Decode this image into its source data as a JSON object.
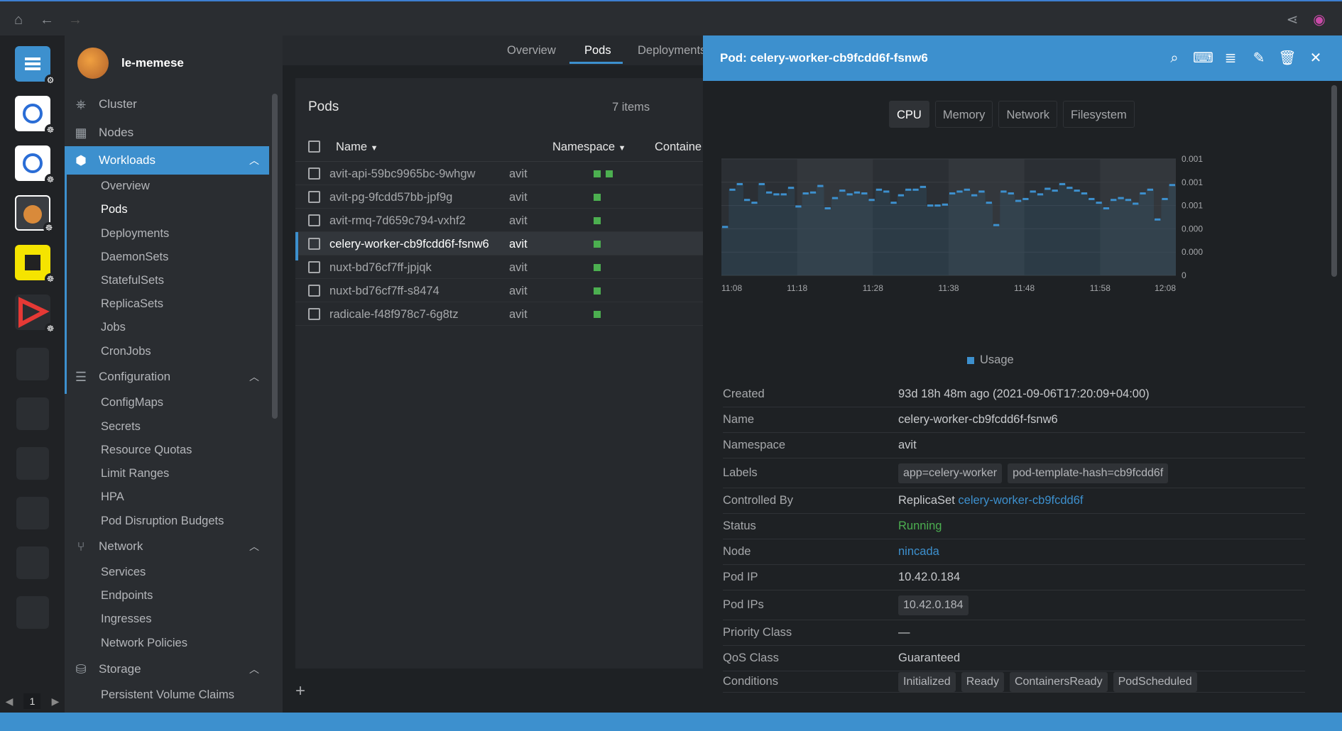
{
  "window": {
    "home_icon": "home-icon",
    "back_icon": "arrow-left-icon",
    "forward_icon": "arrow-right-icon",
    "share_icon": "share-icon",
    "user_icon": "user-circle-icon"
  },
  "hotbar": {
    "page": "1"
  },
  "sidebar": {
    "cluster_name": "le-memese",
    "items": [
      {
        "label": "Cluster"
      },
      {
        "label": "Nodes"
      },
      {
        "label": "Workloads"
      },
      {
        "label": "Configuration"
      },
      {
        "label": "Network"
      },
      {
        "label": "Storage"
      }
    ],
    "workloads": [
      "Overview",
      "Pods",
      "Deployments",
      "DaemonSets",
      "StatefulSets",
      "ReplicaSets",
      "Jobs",
      "CronJobs"
    ],
    "configuration": [
      "ConfigMaps",
      "Secrets",
      "Resource Quotas",
      "Limit Ranges",
      "HPA",
      "Pod Disruption Budgets"
    ],
    "network": [
      "Services",
      "Endpoints",
      "Ingresses",
      "Network Policies"
    ],
    "storage": [
      "Persistent Volume Claims"
    ]
  },
  "tabs": [
    "Overview",
    "Pods",
    "Deployments"
  ],
  "pods": {
    "title": "Pods",
    "count": "7 items",
    "columns": [
      "Name",
      "Namespace",
      "Containe"
    ],
    "rows": [
      {
        "name": "avit-api-59bc9965bc-9whgw",
        "namespace": "avit",
        "containers": 2
      },
      {
        "name": "avit-pg-9fcdd57bb-jpf9g",
        "namespace": "avit",
        "containers": 1
      },
      {
        "name": "avit-rmq-7d659c794-vxhf2",
        "namespace": "avit",
        "containers": 1
      },
      {
        "name": "celery-worker-cb9fcdd6f-fsnw6",
        "namespace": "avit",
        "containers": 1
      },
      {
        "name": "nuxt-bd76cf7ff-jpjqk",
        "namespace": "avit",
        "containers": 1
      },
      {
        "name": "nuxt-bd76cf7ff-s8474",
        "namespace": "avit",
        "containers": 1
      },
      {
        "name": "radicale-f48f978c7-6g8tz",
        "namespace": "avit",
        "containers": 1
      }
    ]
  },
  "drawer": {
    "title": "Pod: celery-worker-cb9fcdd6f-fsnw6",
    "metric_tabs": [
      "CPU",
      "Memory",
      "Network",
      "Filesystem"
    ],
    "legend": "Usage",
    "details": [
      {
        "label": "Created",
        "value": "93d 18h 48m ago (2021-09-06T17:20:09+04:00)"
      },
      {
        "label": "Name",
        "value": "celery-worker-cb9fcdd6f-fsnw6"
      },
      {
        "label": "Namespace",
        "value": "avit"
      },
      {
        "label": "Labels",
        "chips": [
          "app=celery-worker",
          "pod-template-hash=cb9fcdd6f"
        ]
      },
      {
        "label": "Controlled By",
        "value": "ReplicaSet",
        "link": "celery-worker-cb9fcdd6f"
      },
      {
        "label": "Status",
        "value": "Running"
      },
      {
        "label": "Node",
        "link": "nincada"
      },
      {
        "label": "Pod IP",
        "value": "10.42.0.184"
      },
      {
        "label": "Pod IPs",
        "chips": [
          "10.42.0.184"
        ]
      },
      {
        "label": "Priority Class",
        "value": "—"
      },
      {
        "label": "QoS Class",
        "value": "Guaranteed"
      },
      {
        "label": "Conditions",
        "chips": [
          "Initialized",
          "Ready",
          "ContainersReady",
          "PodScheduled"
        ]
      }
    ]
  },
  "chart_data": {
    "type": "line",
    "title": "",
    "x_ticks": [
      "11:08",
      "11:18",
      "11:28",
      "11:38",
      "11:48",
      "11:58",
      "12:08"
    ],
    "y_ticks": [
      "0.001",
      "0.001",
      "0.001",
      "0.000",
      "0.000",
      "0"
    ],
    "series": [
      {
        "name": "Usage",
        "values": [
          0.00052,
          0.00092,
          0.00098,
          0.00081,
          0.00078,
          0.00098,
          0.00089,
          0.00087,
          0.00087,
          0.00094,
          0.00074,
          0.00088,
          0.00089,
          0.00096,
          0.00072,
          0.00083,
          0.00091,
          0.00087,
          0.00089,
          0.00088,
          0.00081,
          0.00092,
          0.0009,
          0.00078,
          0.00086,
          0.00092,
          0.00092,
          0.00095,
          0.00075,
          0.00075,
          0.00076,
          0.00088,
          0.0009,
          0.00092,
          0.00086,
          0.0009,
          0.00078,
          0.00054,
          0.0009,
          0.00088,
          0.0008,
          0.00082,
          0.0009,
          0.00087,
          0.00093,
          0.00091,
          0.00098,
          0.00094,
          0.00091,
          0.00088,
          0.00082,
          0.00078,
          0.00072,
          0.00081,
          0.00083,
          0.00081,
          0.00077,
          0.00088,
          0.00092,
          0.0006,
          0.00082,
          0.00097
        ]
      }
    ],
    "ylim": [
      0,
      0.00125
    ],
    "color": "#3d90ce"
  }
}
